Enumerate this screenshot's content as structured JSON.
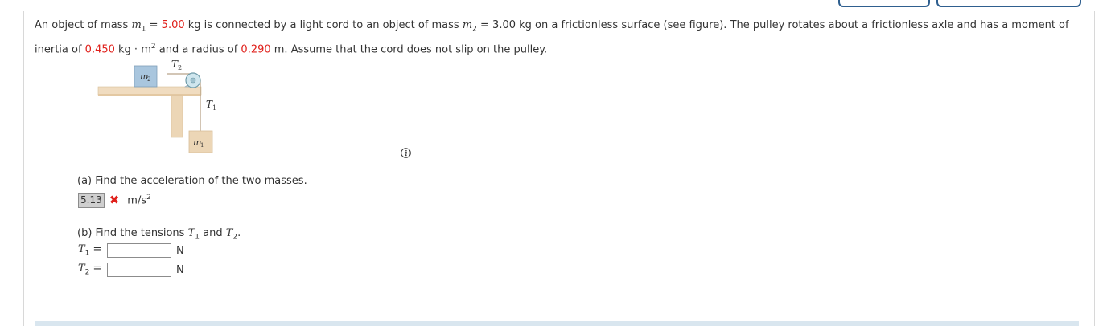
{
  "problem": {
    "intro_a": "An object of mass ",
    "m1_sym": "m",
    "m1_sub": "1",
    "eq1": " = ",
    "m1_val": "5.00",
    "kg_connected": " kg is connected by a light cord to an object of mass ",
    "m2_sym": "m",
    "m2_sub": "2",
    "eq2": " = ",
    "m2_val": "3.00",
    "rest1": " kg on a frictionless surface (see figure). The pulley rotates about a frictionless axle and has a moment of",
    "inertia_text": "inertia of ",
    "I_val": "0.450",
    "I_unit": " kg · m",
    "I_exp": "2",
    "radius_text": " and a radius of ",
    "r_val": "0.290",
    "rest2": " m. Assume that the cord does not slip on the pulley."
  },
  "figure": {
    "m2_label": "m",
    "m2_sub": "2",
    "T2_label": "T",
    "T2_sub": "2",
    "T1_label": "T",
    "T1_sub": "1",
    "m1_label": "m",
    "m1_sub": "1"
  },
  "part_a": {
    "question": "(a) Find the acceleration of the two masses.",
    "answer": "5.13",
    "status": "✖",
    "unit": "m/s",
    "unit_exp": "2"
  },
  "part_b": {
    "question_a": "(b) Find the tensions ",
    "T1": "T",
    "T1_sub": "1",
    "and": " and ",
    "T2": "T",
    "T2_sub": "2",
    "end": ".",
    "row1": {
      "sym": "T",
      "sub": "1",
      "eq": " =",
      "value": "",
      "unit": "N"
    },
    "row2": {
      "sym": "T",
      "sub": "2",
      "eq": " =",
      "value": "",
      "unit": "N"
    }
  },
  "icons": {
    "info": "info-icon",
    "incorrect": "incorrect-x-icon"
  },
  "colors": {
    "given_values": "#e0201b",
    "incorrect": "#e0201b",
    "top_buttons": "#2f5f8f"
  }
}
